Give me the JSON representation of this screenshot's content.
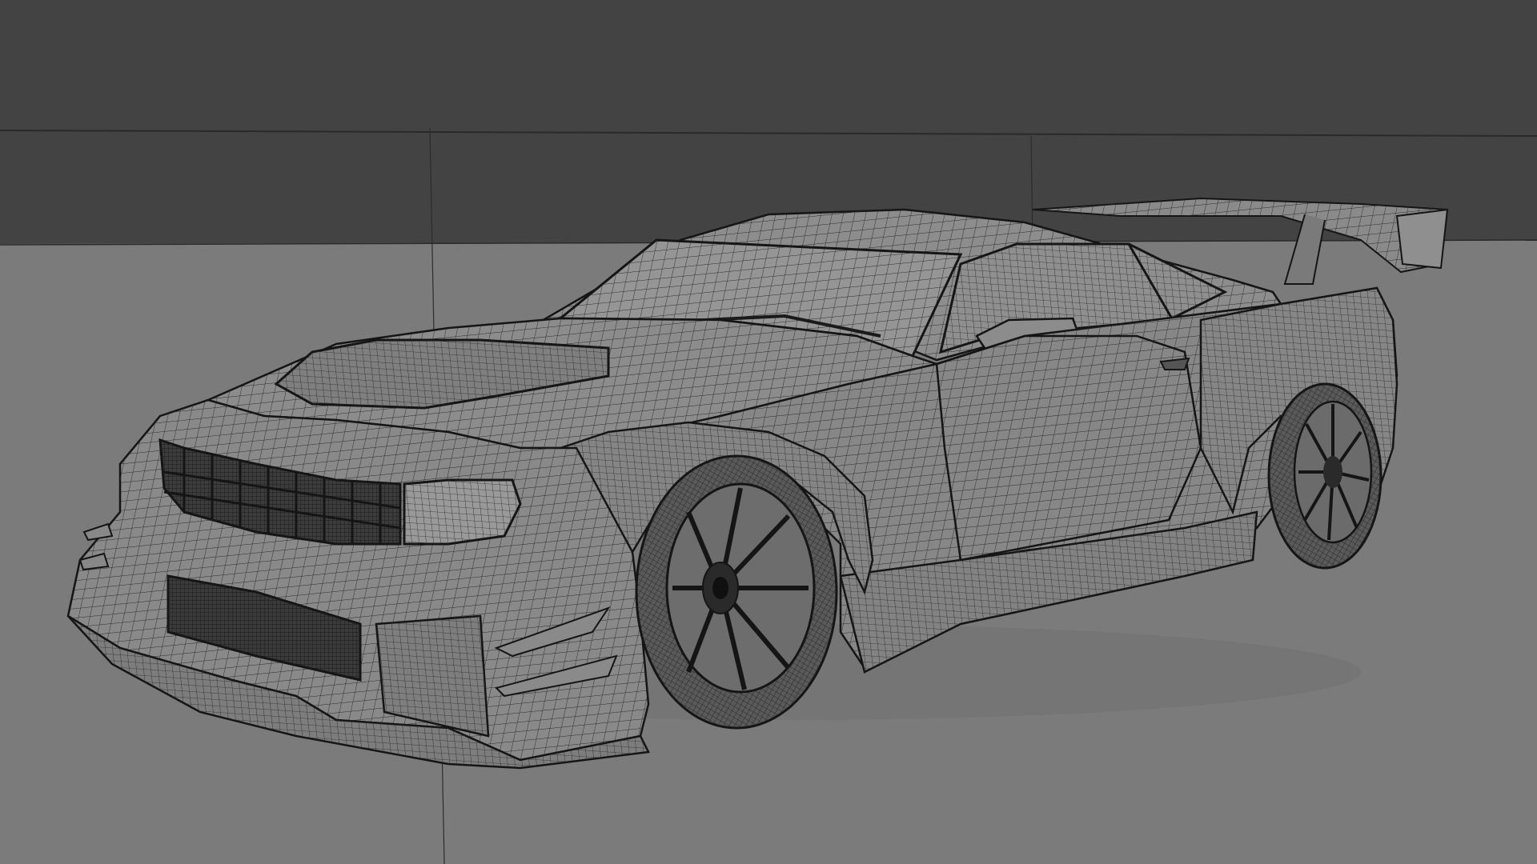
{
  "viewport": {
    "colors": {
      "background_upper": "#434343",
      "background_lower": "#7b7b7b",
      "mesh_fill": "#8a8a8a",
      "mesh_fill_dark": "#6e6e6e",
      "wire": "#202020"
    },
    "view_mode": "wireframe-on-shaded",
    "subject": {
      "body": "car-body-mesh",
      "front_wheel": "wheel-front-left",
      "rear_wheel": "wheel-rear-left",
      "spoiler": "rear-spoiler"
    }
  }
}
